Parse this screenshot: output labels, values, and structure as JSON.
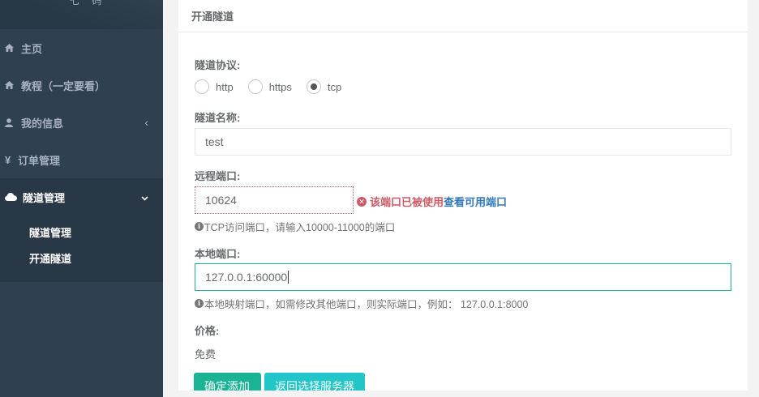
{
  "sidebar": {
    "header_text": "七 码",
    "items": [
      {
        "label": "主页",
        "icon": "home-icon"
      },
      {
        "label": "教程（一定要看）",
        "icon": "home-icon"
      },
      {
        "label": "我的信息",
        "icon": "user-icon",
        "arrow": "‹"
      },
      {
        "label": "订单管理",
        "icon": "yen-icon",
        "icon_char": "¥"
      },
      {
        "label": "隧道管理",
        "icon": "cloud-icon",
        "arrow": "⌄"
      }
    ],
    "sub_items": [
      {
        "label": "隧道管理"
      },
      {
        "label": "开通隧道"
      }
    ]
  },
  "panel": {
    "title": "开通隧道"
  },
  "form": {
    "protocol_label": "隧道协议:",
    "protocols": [
      {
        "label": "http",
        "checked": false
      },
      {
        "label": "https",
        "checked": false
      },
      {
        "label": "tcp",
        "checked": true
      }
    ],
    "name_label": "隧道名称:",
    "name_value": "test",
    "remote_port_label": "远程端口:",
    "remote_port_value": "10624",
    "remote_port_error": "该端口已被使用",
    "remote_port_error_link": "查看可用端口",
    "remote_port_help": "TCP访问端口，请输入10000-11000的端口",
    "local_port_label": "本地端口:",
    "local_port_value": "127.0.0.1:60000",
    "local_port_help": "本地映射端口，如需修改其他端口，则实际端口，例如：  127.0.0.1:8000",
    "price_label": "价格:",
    "price_value": "免费",
    "submit_label": "确定添加",
    "back_label": "返回选择服务器"
  },
  "colors": {
    "sidebar_bg": "#2f4050",
    "sidebar_active": "#293846",
    "primary": "#1ab394",
    "info": "#23c6c8",
    "error": "#cc5965",
    "link": "#337ab7"
  }
}
